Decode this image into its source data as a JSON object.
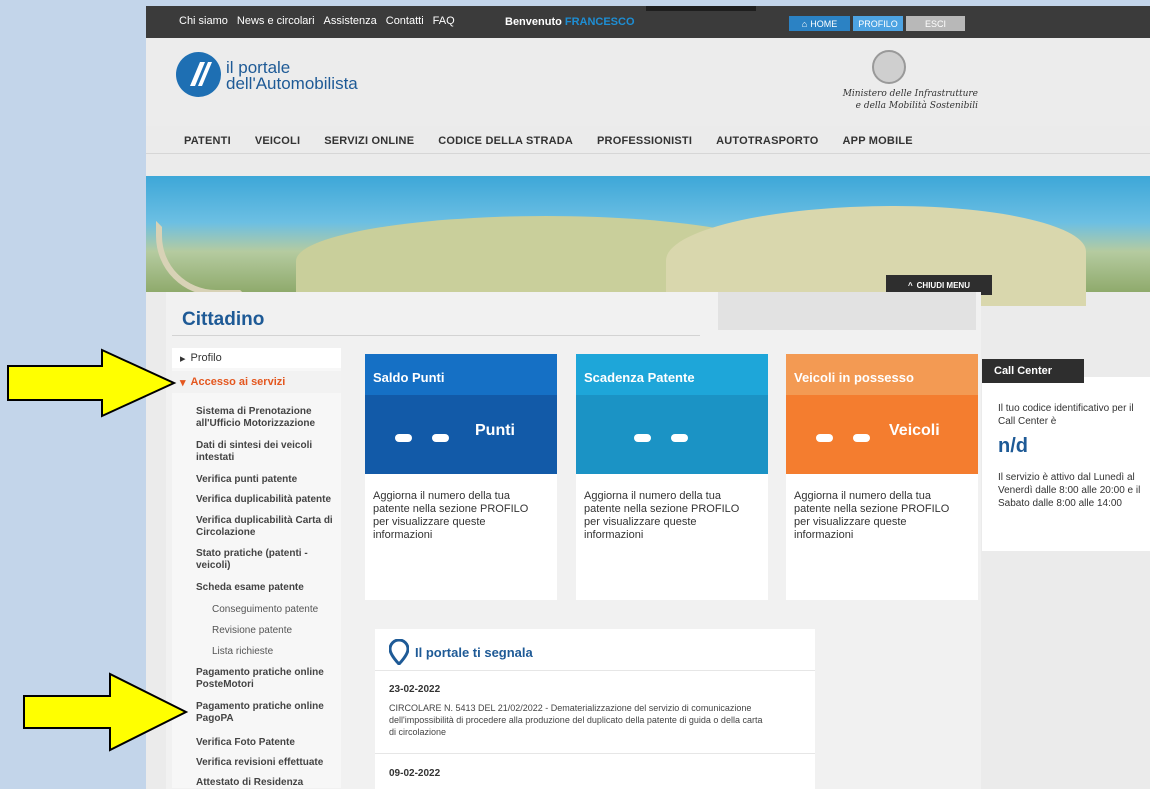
{
  "topbar": {
    "links": [
      "Chi siamo",
      "News e circolari",
      "Assistenza",
      "Contatti",
      "FAQ"
    ],
    "welcome": "Benvenuto",
    "user": "FRANCESCO",
    "home": "HOME",
    "profile": "PROFILO",
    "exit": "ESCI"
  },
  "header": {
    "logo_line1": "il portale",
    "logo_line2": "dell'Automobilista",
    "ministry_line1": "Ministero delle Infrastrutture",
    "ministry_line2": "e della Mobilità Sostenibili"
  },
  "nav": [
    "PATENTI",
    "VEICOLI",
    "SERVIZI ONLINE",
    "CODICE DELLA STRADA",
    "PROFESSIONISTI",
    "AUTOTRASPORTO",
    "APP MOBILE"
  ],
  "banner": {
    "close_menu": "CHIUDI MENU"
  },
  "page_title": "Cittadino",
  "sidebar": {
    "profilo": "Profilo",
    "accesso": "Accesso ai servizi",
    "items": [
      "Sistema di Prenotazione all'Ufficio Motorizzazione",
      "Dati di sintesi dei veicoli intestati",
      "Verifica punti patente",
      "Verifica duplicabilità patente",
      "Verifica duplicabilità Carta di Circolazione",
      "Stato pratiche (patenti - veicoli)",
      "Scheda esame patente"
    ],
    "subitems": [
      "Conseguimento patente",
      "Revisione patente",
      "Lista richieste"
    ],
    "items2": [
      "Pagamento pratiche online PosteMotori",
      "Pagamento pratiche online PagoPA",
      "Verifica Foto Patente",
      "Verifica revisioni effettuate",
      "Attestato di Residenza"
    ]
  },
  "cards": [
    {
      "title": "Saldo Punti",
      "value": "Punti",
      "text": "Aggiorna il numero della tua patente nella sezione PROFILO per visualizzare queste informazioni",
      "color": "#1570c5",
      "body": "#125aa8"
    },
    {
      "title": "Scadenza Patente",
      "value": "",
      "text": "Aggiorna il numero della tua patente nella sezione PROFILO per visualizzare queste informazioni",
      "color": "#1ea6d9",
      "body": "#1b93c5"
    },
    {
      "title": "Veicoli in possesso",
      "value": "Veicoli",
      "text": "Aggiorna il numero della tua patente nella sezione PROFILO per visualizzare queste informazioni",
      "color": "#f39a53",
      "body": "#f47d2f"
    }
  ],
  "callcenter": {
    "title": "Call Center",
    "text1": "Il tuo codice identificativo per il Call Center è",
    "code": "n/d",
    "text2": "Il servizio è attivo dal Lunedì al Venerdì dalle 8:00 alle 20:00 e il Sabato dalle 8:00 alle 14:00"
  },
  "news": {
    "title": "Il portale ti segnala",
    "items": [
      {
        "date": "23-02-2022",
        "text": "CIRCOLARE N. 5413 DEL 21/02/2022 - Dematerializzazione del servizio di comunicazione dell'impossibilità di procedere alla produzione del duplicato della patente di guida o della carta di circolazione"
      },
      {
        "date": "09-02-2022",
        "text": ""
      }
    ]
  }
}
